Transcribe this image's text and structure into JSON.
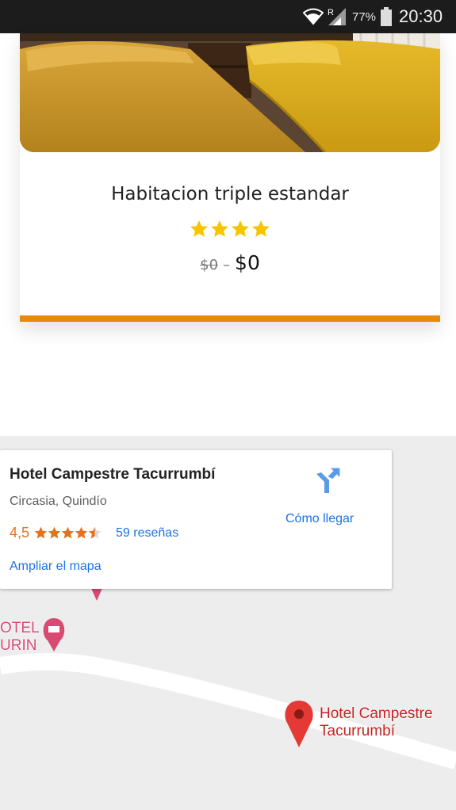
{
  "status_bar": {
    "battery_percent": "77%",
    "time": "20:30",
    "roaming_indicator": "R",
    "icons": [
      "wifi-icon",
      "signal-icon",
      "battery-icon"
    ]
  },
  "room_card": {
    "title": "Habitacion triple estandar",
    "star_count": 4,
    "price_old": "$0",
    "price_separator": "–",
    "price_new": "$0",
    "accent_color": "#e8880d"
  },
  "map": {
    "info_card": {
      "hotel_name": "Hotel Campestre Tacurrumbí",
      "address": "Circasia, Quindío",
      "rating": "4,5",
      "rating_stars": 4.5,
      "reviews": "59 reseñas",
      "enlarge": "Ampliar el mapa",
      "directions": "Cómo llegar"
    },
    "markers": {
      "hotel_label_line1": "Hotel Campestre",
      "hotel_label_line2": "Tacurrumbí",
      "other_label_line1": "OTEL",
      "other_label_line2": "URIN"
    },
    "colors": {
      "link": "#1a73e8",
      "rating": "#e7711b",
      "marker_red": "#c5221f",
      "marker_pink": "#d94a72"
    }
  }
}
